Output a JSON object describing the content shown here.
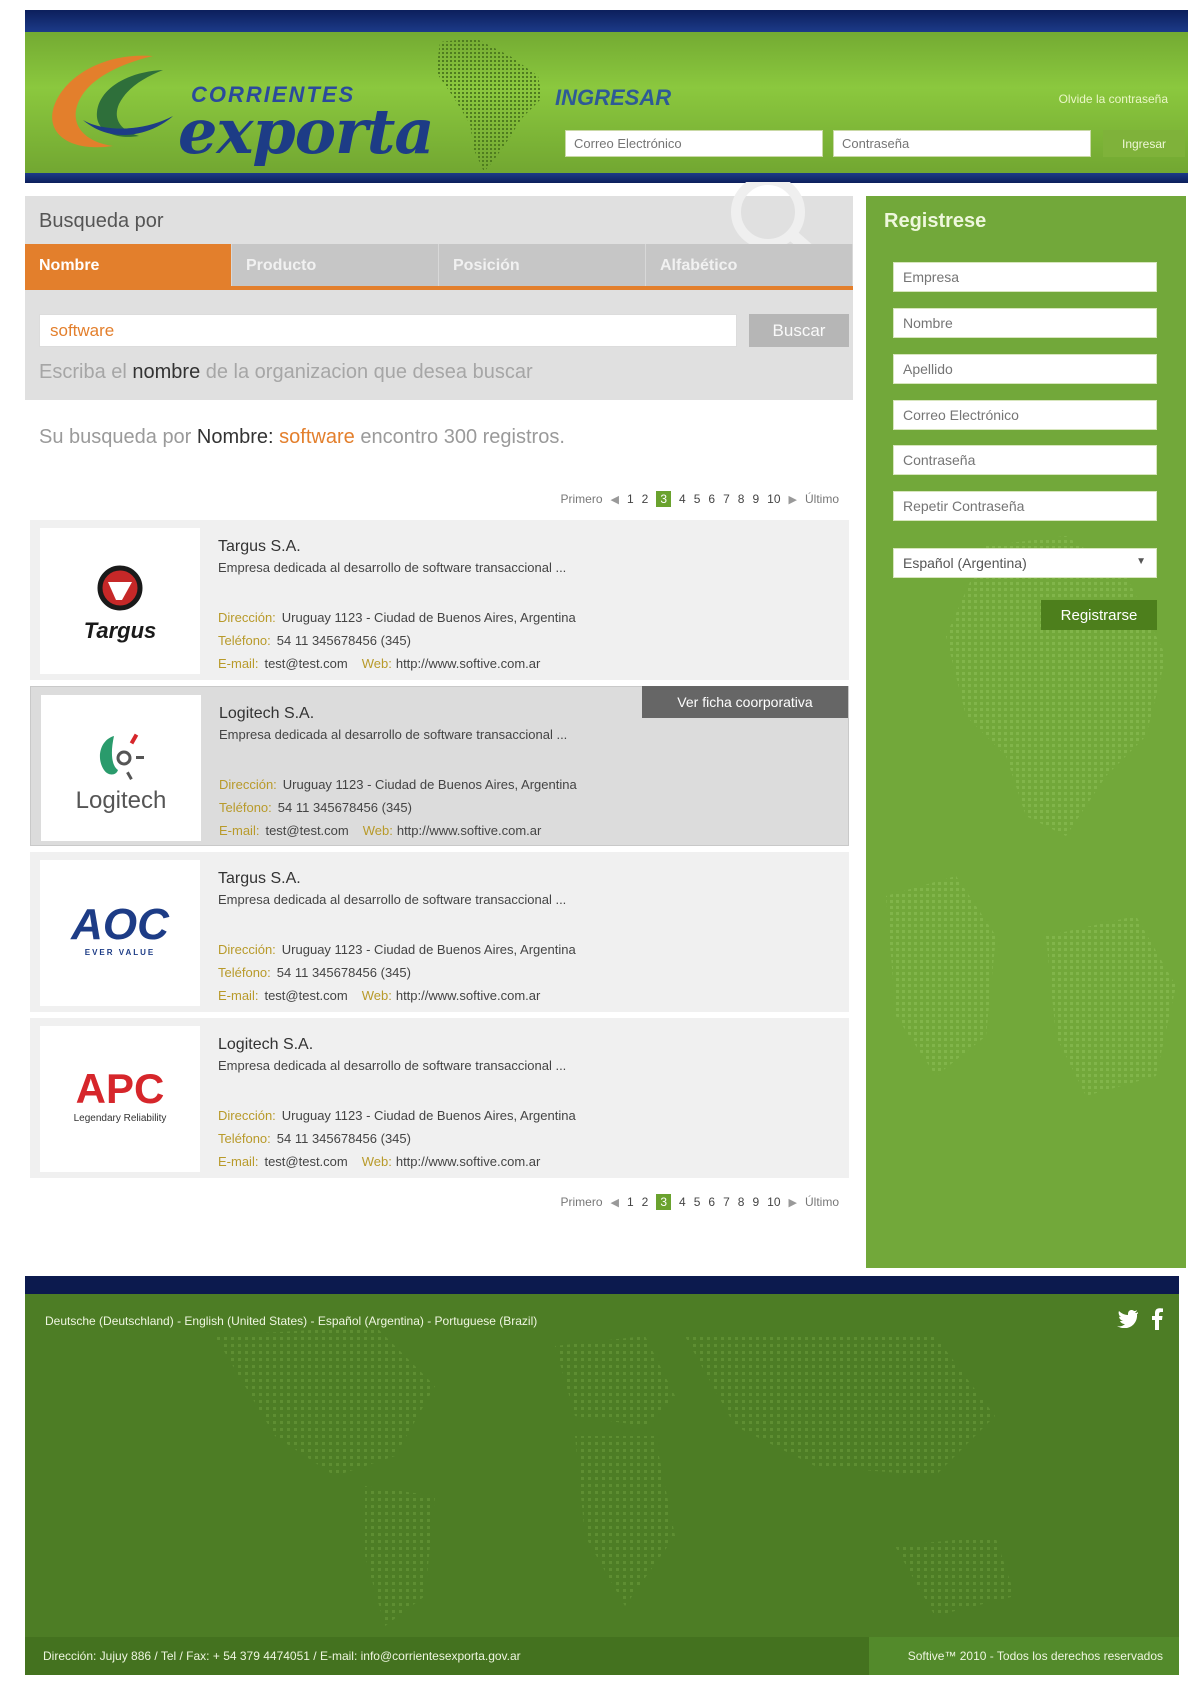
{
  "header": {
    "logo_small": "CORRIENTES",
    "logo_big": "exporta",
    "login_label": "INGRESAR",
    "forgot_password": "Olvide la contraseña",
    "email_placeholder": "Correo Electrónico",
    "password_placeholder": "Contraseña",
    "login_button": "Ingresar"
  },
  "search": {
    "title": "Busqueda por",
    "tabs": [
      {
        "label": "Nombre",
        "active": true
      },
      {
        "label": "Producto",
        "active": false
      },
      {
        "label": "Posición",
        "active": false
      },
      {
        "label": "Alfabético",
        "active": false
      }
    ],
    "input_value": "software",
    "button_label": "Buscar",
    "hint_prefix": "Escriba el ",
    "hint_bold": "nombre",
    "hint_suffix": " de la organizacion que desea buscar"
  },
  "summary": {
    "prefix": "Su busqueda por ",
    "field": "Nombre:",
    "term": "software",
    "suffix": " encontro 300 registros."
  },
  "pagination": {
    "first": "Primero",
    "last": "Último",
    "pages": [
      "1",
      "2",
      "3",
      "4",
      "5",
      "6",
      "7",
      "8",
      "9",
      "10"
    ],
    "current": "3"
  },
  "labels": {
    "direccion": "Dirección:",
    "telefono": "Teléfono:",
    "email": "E-mail:",
    "web": "Web:",
    "ver_ficha": "Ver ficha coorporativa"
  },
  "results": [
    {
      "name": "Targus S.A.",
      "logo": "Targus",
      "description": "Empresa dedicada al desarrollo de software transaccional ...",
      "address": "Uruguay 1123 - Ciudad de Buenos Aires, Argentina",
      "phone": "54 11 345678456 (345)",
      "email": "test@test.com",
      "web": "http://www.softive.com.ar"
    },
    {
      "name": "Logitech S.A.",
      "logo": "Logitech",
      "description": "Empresa dedicada al desarrollo de software transaccional ...",
      "address": "Uruguay 1123 - Ciudad de Buenos Aires, Argentina",
      "phone": "54 11 345678456 (345)",
      "email": "test@test.com",
      "web": "http://www.softive.com.ar"
    },
    {
      "name": "Targus S.A.",
      "logo": "AOC",
      "logo_tagline": "EVER VALUE",
      "description": "Empresa dedicada al desarrollo de software transaccional ...",
      "address": "Uruguay 1123 - Ciudad de Buenos Aires, Argentina",
      "phone": "54 11 345678456 (345)",
      "email": "test@test.com",
      "web": "http://www.softive.com.ar"
    },
    {
      "name": "Logitech S.A.",
      "logo": "APC",
      "logo_tagline": "Legendary Reliability",
      "description": "Empresa dedicada al desarrollo de software transaccional ...",
      "address": "Uruguay 1123 - Ciudad de Buenos Aires, Argentina",
      "phone": "54 11 345678456 (345)",
      "email": "test@test.com",
      "web": "http://www.softive.com.ar"
    }
  ],
  "sidebar": {
    "title": "Registrese",
    "fields": [
      "Empresa",
      "Nombre",
      "Apellido",
      "Correo Electrónico",
      "Contraseña",
      "Repetir Contraseña"
    ],
    "language_selected": "Español (Argentina)",
    "register_button": "Registrarse"
  },
  "footer": {
    "languages": [
      "Deutsche (Deutschland)",
      "English (United States)",
      "Español (Argentina)",
      "Portuguese (Brazil)"
    ],
    "separator": " - ",
    "address": "Dirección: Jujuy 886 / Tel / Fax: + 54 379 4474051 / E-mail: info@corrientesexporta.gov.ar",
    "copyright": "Softive™ 2010 - Todos los derechos reservados"
  },
  "colors": {
    "header_green": "#8bc83e",
    "navy": "#0c1f5c",
    "orange": "#e37f2c",
    "sidebar_green": "#72a83a",
    "footer_green": "#4d7d25"
  },
  "icons": [
    "twitter-icon",
    "facebook-icon",
    "chevron-down-icon",
    "arrow-left-icon",
    "arrow-right-icon",
    "magnifier-icon"
  ]
}
